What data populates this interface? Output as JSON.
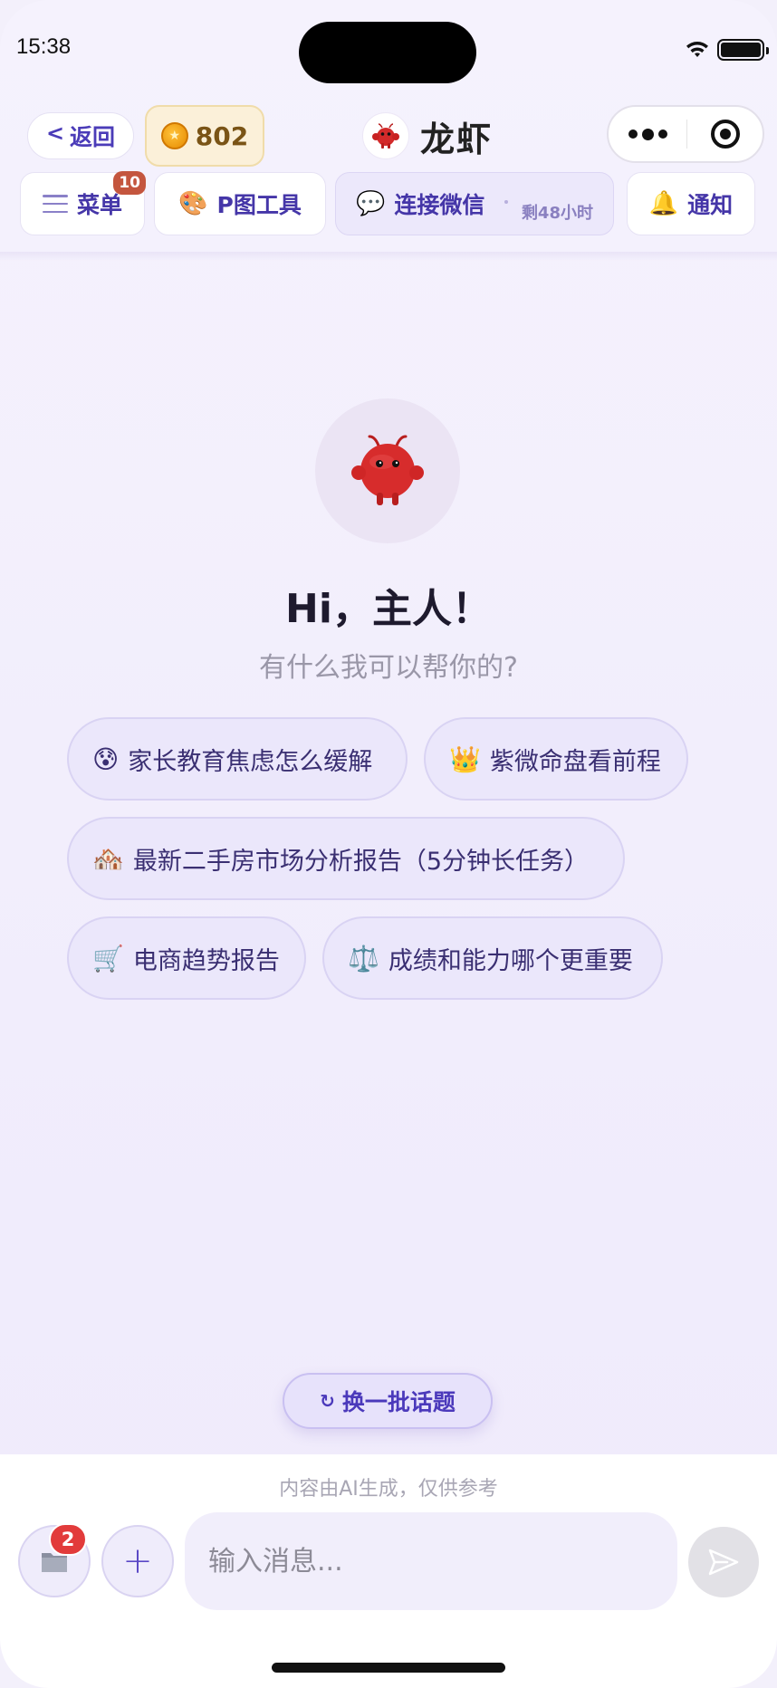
{
  "status_bar": {
    "time": "15:38"
  },
  "nav": {
    "back_label": "返回",
    "back_chevron": "<",
    "coins": "802",
    "title": "龙虾"
  },
  "tools": {
    "menu_label": "菜单",
    "menu_badge": "10",
    "ps_label": "P图工具",
    "ps_emoji": "🎨",
    "wechat_label": "连接微信",
    "wechat_emoji": "💬",
    "wechat_remaining": "剩48小时",
    "notify_label": "通知",
    "notify_emoji": "🔔"
  },
  "hero": {
    "greeting": "Hi，主人！",
    "subtitle": "有什么我可以帮你的?"
  },
  "suggestions": [
    {
      "emoji": "😰",
      "text": "家长教育焦虑怎么缓解"
    },
    {
      "emoji": "👑",
      "text": "紫微命盘看前程"
    },
    {
      "emoji": "🏘️",
      "text": "最新二手房市场分析报告（5分钟长任务）"
    },
    {
      "emoji": "🛒",
      "text": "电商趋势报告"
    },
    {
      "emoji": "⚖️",
      "text": "成绩和能力哪个更重要"
    }
  ],
  "refresh": {
    "icon": "↻",
    "label": "换一批话题"
  },
  "bottom": {
    "disclaimer": "内容由AI生成，仅供参考",
    "folder_badge": "2",
    "plus": "+",
    "input_placeholder": "输入消息..."
  },
  "icons": {
    "status": [
      "wifi-icon",
      "battery-icon"
    ],
    "nav": [
      "coin-icon",
      "lobster-avatar",
      "more-dots-icon",
      "target-icon"
    ],
    "tools": [
      "hamburger-icon",
      "palette-icon",
      "speech-bubble-icon",
      "bell-icon"
    ],
    "bottom": [
      "folder-icon",
      "plus-icon",
      "send-icon"
    ]
  },
  "colors": {
    "accent": "#4b39bb",
    "chip_bg": "#ebe7fb",
    "badge_red": "#e23b3b",
    "coin_bg": "#fbf0d9"
  }
}
